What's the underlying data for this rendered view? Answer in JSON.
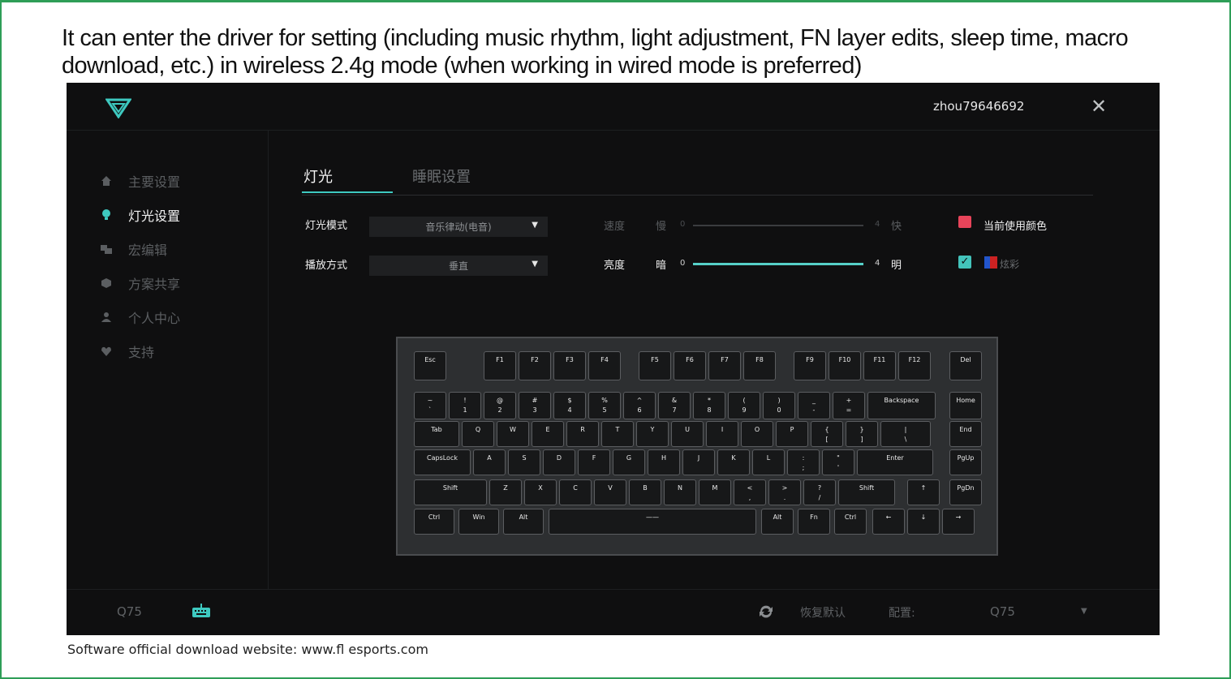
{
  "caption": "It can enter the driver for setting (including music rhythm, light adjustment, FN layer edits, sleep time, macro download, etc.) in wireless 2.4g mode (when working in wired mode is preferred)",
  "footer_note": "Software official download website: www.fl esports.com",
  "app": {
    "username": "zhou79646692",
    "close_label": "✕",
    "sidebar": {
      "items": [
        {
          "label": "主要设置",
          "icon": "home-icon"
        },
        {
          "label": "灯光设置",
          "icon": "bulb-icon"
        },
        {
          "label": "宏编辑",
          "icon": "macro-icon"
        },
        {
          "label": "方案共享",
          "icon": "share-icon"
        },
        {
          "label": "个人中心",
          "icon": "user-icon"
        },
        {
          "label": "支持",
          "icon": "heart-icon"
        }
      ],
      "active_index": 1
    },
    "tabs": {
      "active": "灯光",
      "inactive": "睡眠设置"
    },
    "light_mode": {
      "label": "灯光模式",
      "value": "音乐律动(电音)"
    },
    "play_mode": {
      "label": "播放方式",
      "value": "垂直"
    },
    "speed": {
      "label": "速度",
      "min_label": "慢",
      "max_label": "快",
      "min": "0",
      "max": "4",
      "value": 0
    },
    "brightness": {
      "label": "亮度",
      "min_label": "暗",
      "max_label": "明",
      "min": "0",
      "max": "4",
      "value": 4
    },
    "current_color": {
      "label": "当前使用颜色",
      "color": "#e8445a"
    },
    "colorful": {
      "label": "炫彩",
      "checked": true
    },
    "bottom": {
      "device": "Q75",
      "restore_label": "恢复默认",
      "config_label": "配置:",
      "config_value": "Q75"
    },
    "colors": {
      "accent": "#3ec9c0",
      "background": "#0f0f10"
    },
    "keyboard": {
      "row_f": [
        "Esc",
        "F1",
        "F2",
        "F3",
        "F4",
        "F5",
        "F6",
        "F7",
        "F8",
        "F9",
        "F10",
        "F11",
        "F12",
        "Del"
      ],
      "row_num": [
        [
          "~",
          "`"
        ],
        [
          "!",
          "1"
        ],
        [
          "@",
          "2"
        ],
        [
          "#",
          "3"
        ],
        [
          "$",
          "4"
        ],
        [
          "%",
          "5"
        ],
        [
          "^",
          "6"
        ],
        [
          "&",
          "7"
        ],
        [
          "*",
          "8"
        ],
        [
          "(",
          "9"
        ],
        [
          ")",
          "0"
        ],
        [
          "_",
          "-"
        ],
        [
          "+",
          "="
        ],
        [
          "Backspace",
          ""
        ],
        [
          "Home",
          ""
        ]
      ],
      "row_tab": [
        [
          "Tab",
          ""
        ],
        [
          "Q",
          ""
        ],
        [
          "W",
          ""
        ],
        [
          "E",
          ""
        ],
        [
          "R",
          ""
        ],
        [
          "T",
          ""
        ],
        [
          "Y",
          ""
        ],
        [
          "U",
          ""
        ],
        [
          "I",
          ""
        ],
        [
          "O",
          ""
        ],
        [
          "P",
          ""
        ],
        [
          "{",
          "["
        ],
        [
          "}",
          "]"
        ],
        [
          "|",
          "\\"
        ],
        [
          "End",
          ""
        ]
      ],
      "row_caps": [
        [
          "CapsLock",
          ""
        ],
        [
          "A",
          ""
        ],
        [
          "S",
          ""
        ],
        [
          "D",
          ""
        ],
        [
          "F",
          ""
        ],
        [
          "G",
          ""
        ],
        [
          "H",
          ""
        ],
        [
          "J",
          ""
        ],
        [
          "K",
          ""
        ],
        [
          "L",
          ""
        ],
        [
          ":",
          ";"
        ],
        [
          "\"",
          "'"
        ],
        [
          "Enter",
          ""
        ],
        [
          "PgUp",
          ""
        ]
      ],
      "row_shift": [
        [
          "Shift",
          ""
        ],
        [
          "Z",
          ""
        ],
        [
          "X",
          ""
        ],
        [
          "C",
          ""
        ],
        [
          "V",
          ""
        ],
        [
          "B",
          ""
        ],
        [
          "N",
          ""
        ],
        [
          "M",
          ""
        ],
        [
          "<",
          ","
        ],
        [
          ">",
          "."
        ],
        [
          "?",
          "/"
        ],
        [
          "Shift",
          ""
        ],
        [
          "↑",
          ""
        ],
        [
          "PgDn",
          ""
        ]
      ],
      "row_bottom": [
        [
          "Ctrl",
          ""
        ],
        [
          "Win",
          ""
        ],
        [
          "Alt",
          ""
        ],
        [
          "——",
          ""
        ],
        [
          "Alt",
          ""
        ],
        [
          "Fn",
          ""
        ],
        [
          "Ctrl",
          ""
        ],
        [
          "←",
          ""
        ],
        [
          "↓",
          ""
        ],
        [
          "→",
          ""
        ]
      ]
    }
  }
}
